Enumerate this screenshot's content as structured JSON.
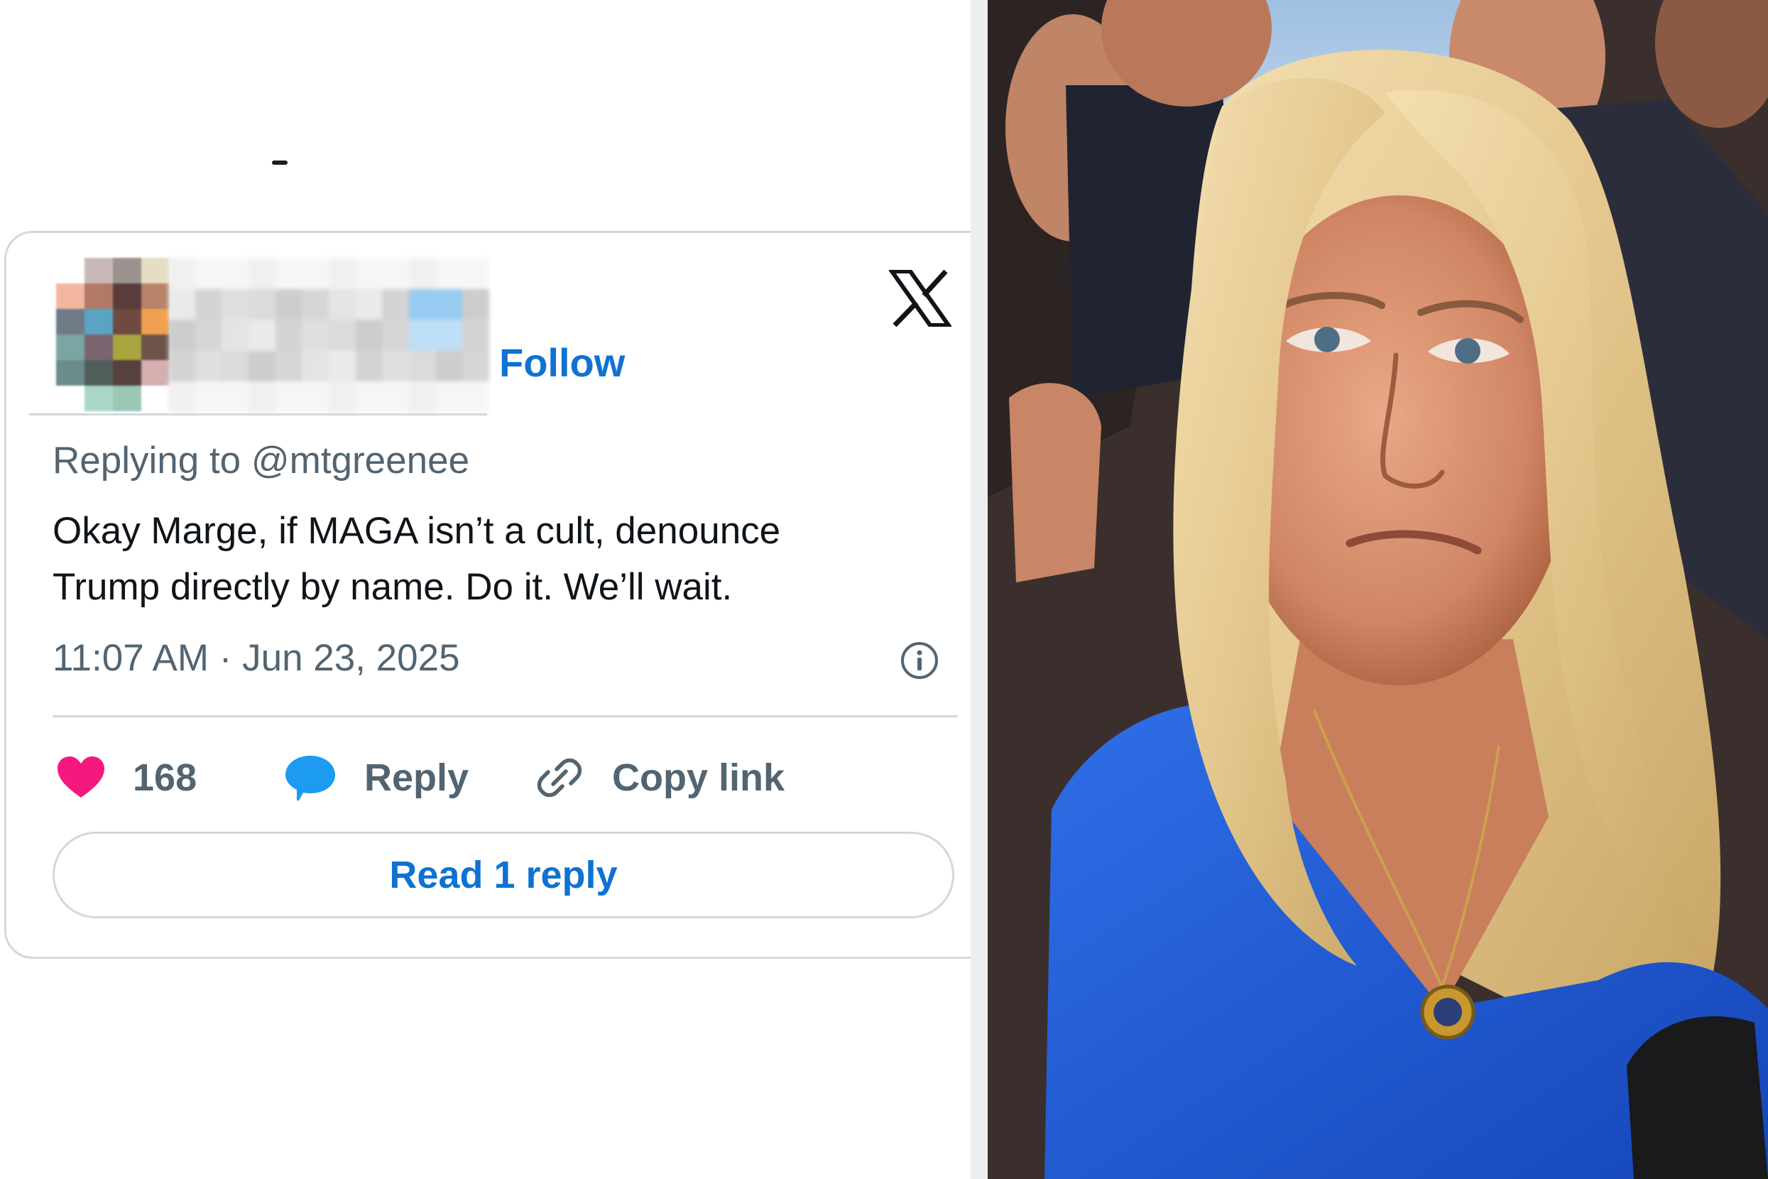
{
  "tweet": {
    "follow_label": "Follow",
    "reply_context": "Replying to @mtgreenee",
    "text_lines": [
      "Okay Marge, if MAGA isn’t a cult, denounce",
      "Trump directly by name. Do it. We’ll wait."
    ],
    "timestamp": "11:07 AM · Jun 23, 2025",
    "actions": {
      "like_count": "168",
      "reply_label": "Reply",
      "copy_link_label": "Copy link"
    },
    "read_replies_label": "Read 1 reply",
    "platform_icon": "x-logo-icon",
    "info_icon": "info-icon"
  },
  "colors": {
    "link_blue": "#0f72d0",
    "like_pink": "#f5197f",
    "reply_blue": "#1d9bf0",
    "muted_text": "#536471",
    "border": "#cfd9de"
  },
  "photo": {
    "subject_top": "blue-top",
    "hair": "blonde",
    "accessory": "gold-pendant-necklace"
  }
}
